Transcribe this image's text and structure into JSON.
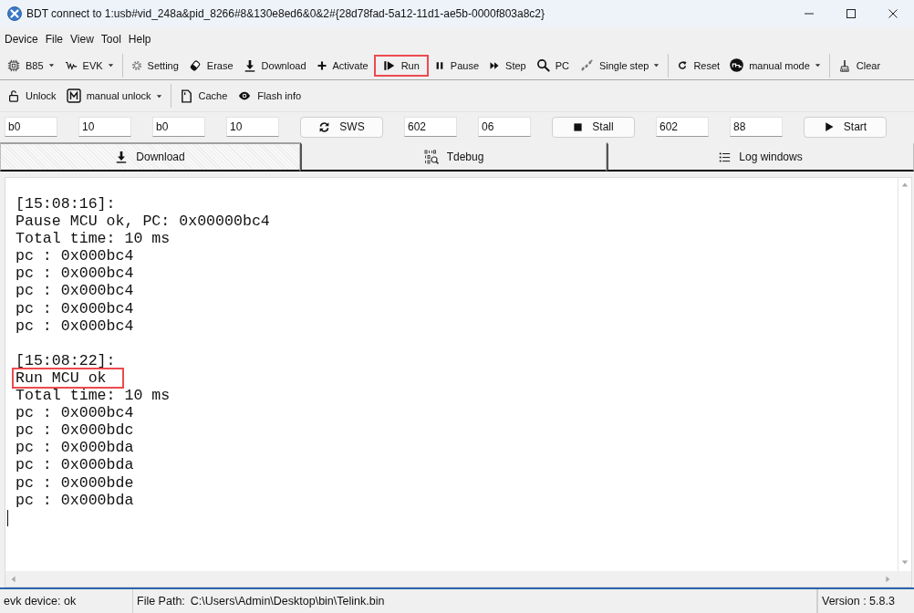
{
  "window": {
    "title": "BDT connect to 1:usb#vid_248a&pid_8266#8&130e8ed6&0&2#{28d78fad-5a12-11d1-ae5b-0000f803a8c2}"
  },
  "menu": [
    "Device",
    "File",
    "View",
    "Tool",
    "Help"
  ],
  "toolbar_1": {
    "groups": [
      [
        {
          "kind": "dropdown",
          "label": "B85",
          "highlighted": false
        },
        {
          "kind": "dropdown",
          "label": "EVK",
          "highlighted": false
        }
      ],
      [
        {
          "kind": "button",
          "label": "Setting",
          "highlighted": false
        },
        {
          "kind": "button",
          "label": "Erase",
          "highlighted": false
        },
        {
          "kind": "button",
          "label": "Download",
          "highlighted": false
        },
        {
          "kind": "button",
          "label": "Activate",
          "highlighted": false
        },
        {
          "kind": "button",
          "label": "Run",
          "highlighted": true
        },
        {
          "kind": "button",
          "label": "Pause",
          "highlighted": false
        },
        {
          "kind": "button",
          "label": "Step",
          "highlighted": false
        },
        {
          "kind": "button",
          "label": "PC",
          "highlighted": false
        },
        {
          "kind": "dropdown",
          "label": "Single step",
          "highlighted": false
        }
      ],
      [
        {
          "kind": "button",
          "label": "Reset",
          "highlighted": false
        },
        {
          "kind": "dropdown",
          "label": "manual mode",
          "highlighted": false
        }
      ],
      [
        {
          "kind": "button",
          "label": "Clear",
          "highlighted": false
        }
      ]
    ]
  },
  "toolbar_2": {
    "groups": [
      [
        {
          "kind": "button",
          "label": "Unlock",
          "highlighted": false
        },
        {
          "kind": "dropdown",
          "label": "manual unlock",
          "highlighted": false
        }
      ],
      [
        {
          "kind": "button",
          "label": "Cache",
          "highlighted": false
        },
        {
          "kind": "button",
          "label": "Flash info",
          "highlighted": false
        }
      ]
    ]
  },
  "controls": [
    {
      "kind": "input",
      "value": "b0"
    },
    {
      "kind": "input",
      "value": "10"
    },
    {
      "kind": "input",
      "value": "b0"
    },
    {
      "kind": "input",
      "value": "10"
    },
    {
      "kind": "button",
      "label": "SWS"
    },
    {
      "kind": "input",
      "value": "602"
    },
    {
      "kind": "input",
      "value": "06"
    },
    {
      "kind": "button",
      "label": "Stall"
    },
    {
      "kind": "input",
      "value": "602"
    },
    {
      "kind": "input",
      "value": "88"
    },
    {
      "kind": "button",
      "label": "Start"
    }
  ],
  "tabs": [
    {
      "label": "Download",
      "selected": true
    },
    {
      "label": "Tdebug",
      "selected": false
    },
    {
      "label": "Log windows",
      "selected": false
    }
  ],
  "log": {
    "entries": [
      {
        "lines": [
          {
            "text": "[15:08:16]:",
            "highlighted": false
          },
          {
            "text": "Pause MCU ok, PC: 0x00000bc4",
            "highlighted": false
          },
          {
            "text": "Total time: 10 ms",
            "highlighted": false
          },
          {
            "text": "pc : 0x000bc4",
            "highlighted": false
          },
          {
            "text": "pc : 0x000bc4",
            "highlighted": false
          },
          {
            "text": "pc : 0x000bc4",
            "highlighted": false
          },
          {
            "text": "pc : 0x000bc4",
            "highlighted": false
          },
          {
            "text": "pc : 0x000bc4",
            "highlighted": false
          }
        ]
      },
      {
        "lines": [
          {
            "text": "[15:08:22]:",
            "highlighted": false
          },
          {
            "text": "Run MCU ok",
            "highlighted": true
          },
          {
            "text": "Total time: 10 ms",
            "highlighted": false
          },
          {
            "text": "pc : 0x000bc4",
            "highlighted": false
          },
          {
            "text": "pc : 0x000bdc",
            "highlighted": false
          },
          {
            "text": "pc : 0x000bda",
            "highlighted": false
          },
          {
            "text": "pc : 0x000bda",
            "highlighted": false
          },
          {
            "text": "pc : 0x000bde",
            "highlighted": false
          },
          {
            "text": "pc : 0x000bda",
            "highlighted": false
          }
        ]
      }
    ]
  },
  "status_bar": {
    "device": "evk device: ok",
    "file_path": {
      "label": "File Path:",
      "value": "C:\\Users\\Admin\\Desktop\\bin\\Telink.bin"
    },
    "version": "Version : 5.8.3"
  }
}
